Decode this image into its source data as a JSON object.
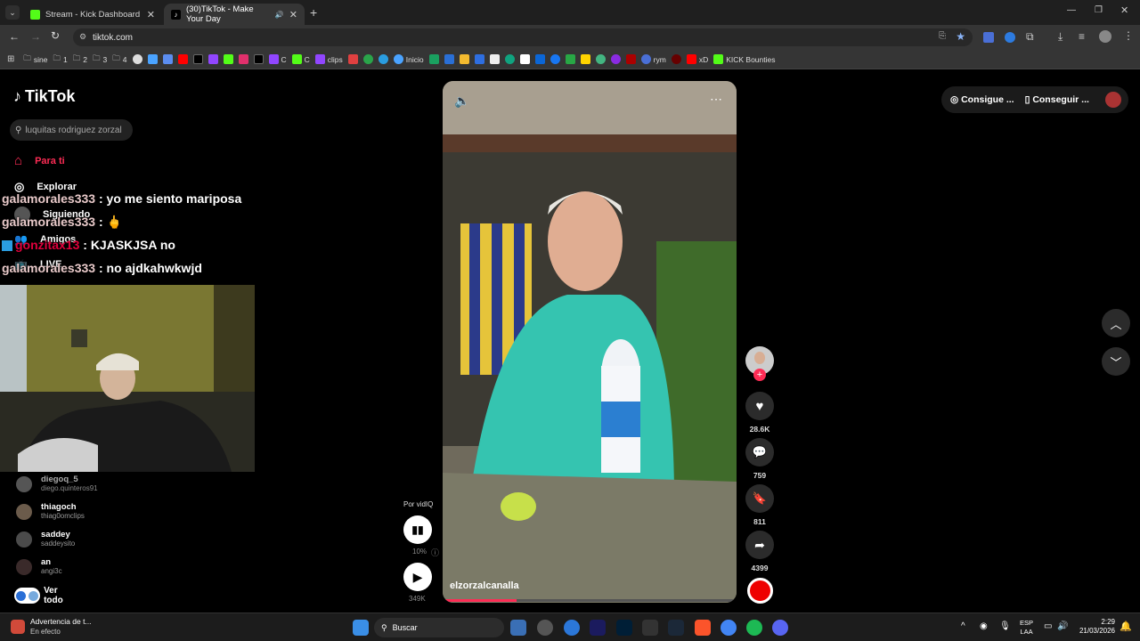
{
  "browser": {
    "tabs": [
      {
        "title": "Stream - Kick Dashboard",
        "active": false
      },
      {
        "title": "(30)TikTok - Make Your Day",
        "active": true
      }
    ],
    "url": "tiktok.com",
    "bookmarks": [
      "sine",
      "1",
      "2",
      "3",
      "4",
      "C",
      "C",
      "clips",
      "Inicio",
      "rym",
      "xD",
      "KICK Bounties"
    ]
  },
  "tiktok": {
    "logo": "TikTok",
    "search_placeholder": "luquitas rodriguez zorzal",
    "nav": [
      {
        "label": "Para ti",
        "icon": "home-icon",
        "active": true
      },
      {
        "label": "Explorar",
        "icon": "compass-icon"
      },
      {
        "label": "Siguiendo",
        "icon": "following-icon"
      },
      {
        "label": "Amigos",
        "icon": "friends-icon"
      },
      {
        "label": "LIVE",
        "icon": "live-icon"
      }
    ],
    "following": [
      {
        "name": "diegoq_5",
        "handle": "diego.quinteros91"
      },
      {
        "name": "thiagoch",
        "handle": "thiag0omclips"
      },
      {
        "name": "saddey",
        "handle": "saddeysito"
      },
      {
        "name": "an",
        "handle": "angi3c"
      }
    ],
    "see_all": "Ver todo",
    "header_buttons": [
      "Consigue ...",
      "Conseguir ..."
    ],
    "video": {
      "author": "elzorzalcanalla",
      "progress": 0.25,
      "likes": "28.6K",
      "comments": "759",
      "saves": "811",
      "shares": "4399"
    },
    "vidiq": {
      "label": "Por vidIQ",
      "percent": "10%",
      "views": "349K"
    }
  },
  "chat": [
    {
      "user": "galamorales333",
      "msg": "yo me siento mariposa"
    },
    {
      "user": "galamorales333",
      "msg": "🖕"
    },
    {
      "user": "gonzitax13",
      "msg": "KJASKJSA no",
      "color": "#e0003c"
    },
    {
      "user": "galamorales333",
      "msg": "no ajdkahwkwjd"
    }
  ],
  "taskbar": {
    "notification_title": "Advertencia de t...",
    "notification_sub": "En efecto",
    "search": "Buscar",
    "lang": "ESP",
    "lang2": "LAA",
    "time": "2:29",
    "date": "21/03/2026"
  }
}
